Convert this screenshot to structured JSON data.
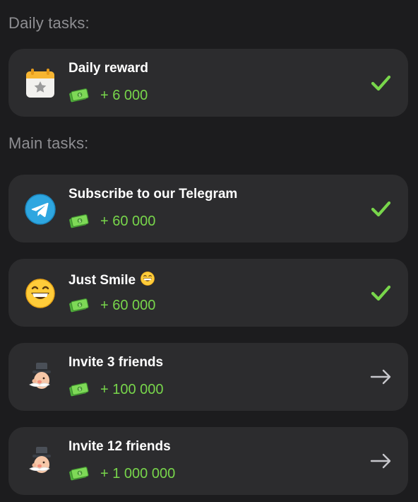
{
  "sections": {
    "daily_title": "Daily tasks:",
    "main_title": "Main tasks:"
  },
  "tasks": [
    {
      "title": "Daily reward",
      "reward": "+ 6 000",
      "icon": "calendar-star-icon",
      "status": "completed",
      "status_icon": "check-icon"
    },
    {
      "title": "Subscribe to our Telegram",
      "reward": "+ 60 000",
      "icon": "telegram-icon",
      "status": "completed",
      "status_icon": "check-icon"
    },
    {
      "title": "Just Smile",
      "title_emoji": "grinning-face-icon",
      "reward": "+ 60 000",
      "icon": "grinning-face-icon",
      "status": "completed",
      "status_icon": "check-icon"
    },
    {
      "title": "Invite 3 friends",
      "reward": "+ 100 000",
      "icon": "monopoly-man-icon",
      "status": "open",
      "status_icon": "arrow-right-icon"
    },
    {
      "title": "Invite 12 friends",
      "reward": "+ 1 000 000",
      "icon": "monopoly-man-icon",
      "status": "open",
      "status_icon": "arrow-right-icon"
    }
  ],
  "colors": {
    "background": "#1c1c1e",
    "card": "#2c2c2e",
    "accent_green": "#78d64b",
    "section_text": "#8e8e92"
  },
  "reward_icon": "cash-icon"
}
